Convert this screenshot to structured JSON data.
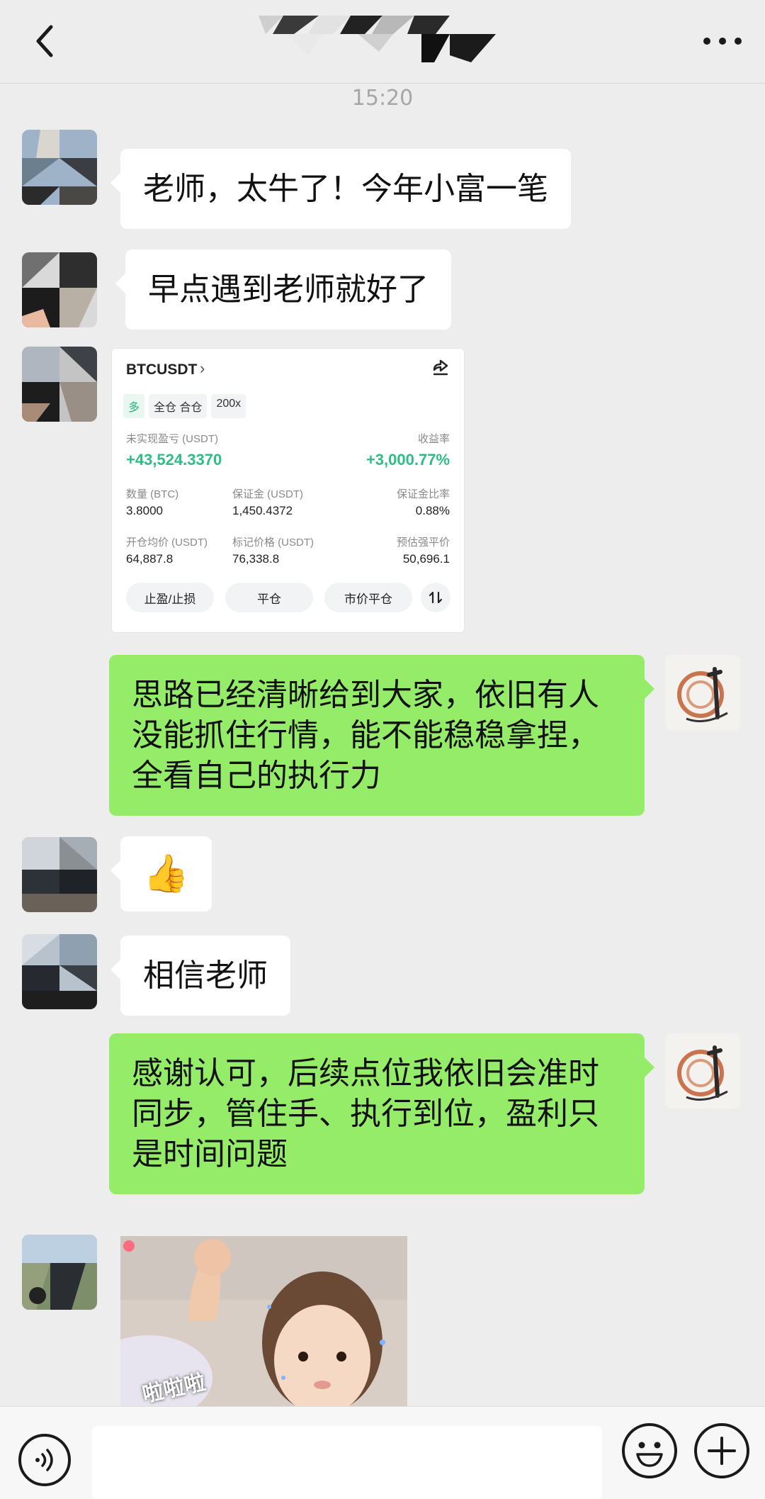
{
  "header": {
    "back_icon": "chevron-left-icon",
    "title": "",
    "more_icon": "more-dots-icon"
  },
  "timestamp": "15:20",
  "messages": [
    {
      "side": "left",
      "text": "老师，太牛了！今年小富一笔"
    },
    {
      "side": "left",
      "text": "早点遇到老师就好了"
    },
    {
      "side": "left",
      "type": "trade-card"
    },
    {
      "side": "right",
      "text": "思路已经清晰给到大家，依旧有人没能抓住行情，能不能稳稳拿捏，全看自己的执行力"
    },
    {
      "side": "left",
      "type": "emoji",
      "text": "👍"
    },
    {
      "side": "left",
      "text": "相信老师"
    },
    {
      "side": "right",
      "text": "感谢认可，后续点位我依旧会准时同步，管住手、执行到位，盈利只是时间问题"
    },
    {
      "side": "left",
      "type": "image",
      "overlay_text": "啦啦啦"
    }
  ],
  "trade_card": {
    "symbol": "BTCUSDT",
    "chevron": "›",
    "share_icon": "share-icon",
    "tags": [
      "多",
      "全仓 合仓",
      "200x"
    ],
    "unrealized_label": "未实现盈亏 (USDT)",
    "unrealized_value": "+43,524.3370",
    "roi_label": "收益率",
    "roi_value": "+3,000.77%",
    "qty_label": "数量 (BTC)",
    "qty_value": "3.8000",
    "margin_label": "保证金 (USDT)",
    "margin_value": "1,450.4372",
    "margin_ratio_label": "保证金比率",
    "margin_ratio_value": "0.88%",
    "entry_label": "开仓均价 (USDT)",
    "entry_value": "64,887.8",
    "mark_label": "标记价格 (USDT)",
    "mark_value": "76,338.8",
    "liq_label": "预估强平价",
    "liq_value": "50,696.1",
    "buttons": [
      "止盈/止损",
      "平仓",
      "市价平仓"
    ],
    "swap_icon": "swap-icon",
    "colors": {
      "profit": "#2ebd85"
    }
  },
  "input_bar": {
    "voice_icon": "voice-icon",
    "input_value": "",
    "emoji_icon": "emoji-icon",
    "plus_icon": "plus-icon"
  },
  "colors": {
    "background": "#ededed",
    "self_bubble": "#95ec69",
    "other_bubble": "#ffffff"
  }
}
